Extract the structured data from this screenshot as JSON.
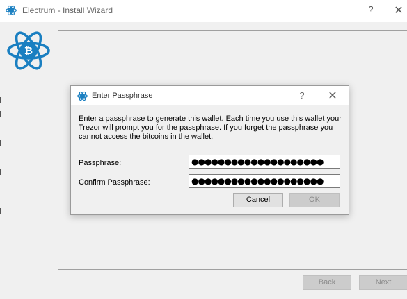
{
  "window": {
    "title": "Electrum  -  Install Wizard",
    "help_glyph": "?",
    "close_glyph": "✕",
    "app_icon": "electrum-logo-icon",
    "brand_color": "#1a7fc1"
  },
  "nav": {
    "back_label": "Back",
    "next_label": "Next"
  },
  "dialog": {
    "title": "Enter Passphrase",
    "help_glyph": "?",
    "close_glyph": "✕",
    "message": "Enter a passphrase to generate this wallet.  Each time you use this wallet your\nTrezor will prompt you for the passphrase.  If you forget the passphrase you\ncannot access the bitcoins in the wallet.",
    "passphrase_label": "Passphrase:",
    "passphrase_value": "●●●●●●●●●●●●●●●●●●●●",
    "confirm_label": "Confirm Passphrase:",
    "confirm_value": "●●●●●●●●●●●●●●●●●●●●",
    "cancel_label": "Cancel",
    "ok_label": "OK"
  }
}
